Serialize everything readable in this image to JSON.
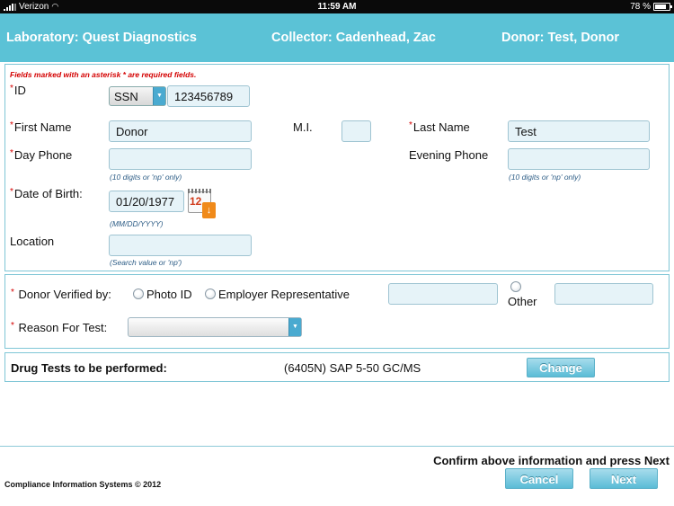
{
  "status_bar": {
    "carrier": "Verizon",
    "wifi_icon": "wifi-icon",
    "time": "11:59 AM",
    "battery": "78 %",
    "battery_level": 0.78
  },
  "header": {
    "laboratory": "Laboratory: Quest Diagnostics",
    "collector": "Collector: Cadenhead, Zac",
    "donor": "Donor: Test, Donor"
  },
  "required_note": "Fields marked with an asterisk * are required fields.",
  "required_marker": "*",
  "id_field": {
    "label": "ID",
    "type_value": "SSN",
    "value": "123456789"
  },
  "first_name": {
    "label": "First Name",
    "value": "Donor"
  },
  "middle_initial": {
    "label": "M.I.",
    "value": ""
  },
  "last_name": {
    "label": "Last Name",
    "value": "Test"
  },
  "day_phone": {
    "label": "Day Phone",
    "value": "",
    "hint": "(10 digits or 'np' only)"
  },
  "evening_phone": {
    "label": "Evening Phone",
    "value": "",
    "hint": "(10 digits or 'np' only)"
  },
  "dob": {
    "label": "Date of Birth:",
    "value": "01/20/1977",
    "hint": "(MM/DD/YYYY)",
    "calendar_icon": "calendar-icon",
    "calendar_num": "12"
  },
  "location": {
    "label": "Location",
    "value": "",
    "hint": "(Search value or 'np')"
  },
  "verification": {
    "label": "Donor Verified by:",
    "options": [
      "Photo ID",
      "Employer Representative",
      "Other"
    ],
    "employer_value": "",
    "other_value": ""
  },
  "reason": {
    "label": "Reason For Test:",
    "value": ""
  },
  "drug_tests": {
    "label": "Drug Tests to be performed:",
    "value": "(6405N) SAP 5-50 GC/MS",
    "change_label": "Change"
  },
  "footer": {
    "confirm_text": "Confirm above information and press Next",
    "copyright": "Compliance Information Systems © 2012",
    "cancel_label": "Cancel",
    "next_label": "Next"
  },
  "colors": {
    "header_bg": "#5bc2d6",
    "field_bg": "#e6f3f8",
    "required": "#d40000",
    "button": "#5bbcd6"
  }
}
